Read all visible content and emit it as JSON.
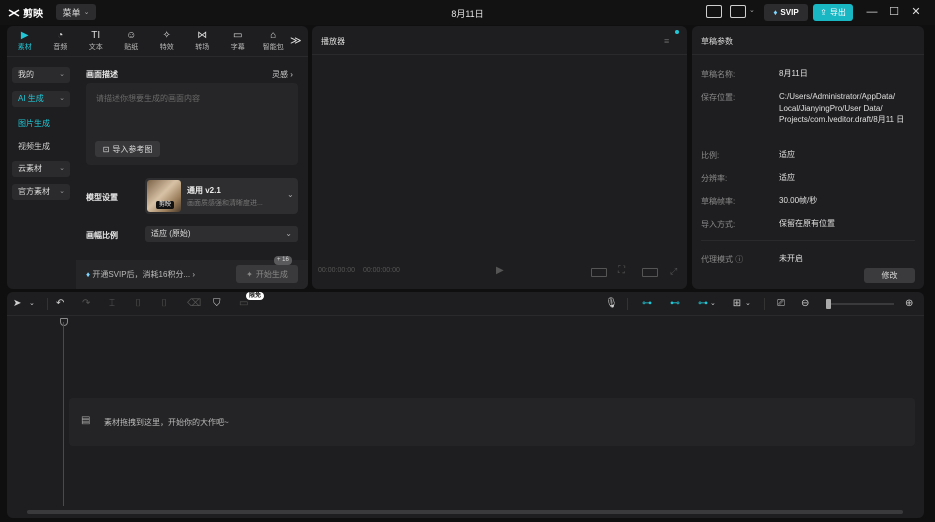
{
  "app": {
    "name": "剪映",
    "menu_label": "菜单",
    "title": "8月11日",
    "svip_label": "SVIP",
    "export_label": "导出"
  },
  "media_tabs": [
    {
      "label": "素材",
      "icon": "media-icon",
      "glyph": "▶",
      "active": true
    },
    {
      "label": "音频",
      "icon": "audio-icon",
      "glyph": "◔",
      "active": false
    },
    {
      "label": "文本",
      "icon": "text-icon",
      "glyph": "TI",
      "active": false
    },
    {
      "label": "贴纸",
      "icon": "sticker-icon",
      "glyph": "☺",
      "active": false
    },
    {
      "label": "特效",
      "icon": "effects-icon",
      "glyph": "✧",
      "active": false
    },
    {
      "label": "转场",
      "icon": "transition-icon",
      "glyph": "⋈",
      "active": false
    },
    {
      "label": "字幕",
      "icon": "subtitle-icon",
      "glyph": "▭",
      "active": false
    },
    {
      "label": "智能包",
      "icon": "smart-package-icon",
      "glyph": "⌂",
      "active": false
    }
  ],
  "media_tabs_more": "≫",
  "sidebar": {
    "mine": "我的",
    "ai_generate": "AI 生成",
    "image_generate": "图片生成",
    "video_generate": "视频生成",
    "cloud_material": "云素材",
    "official_material": "官方素材"
  },
  "ai_gen": {
    "description_label": "画面描述",
    "inspiration_label": "灵感",
    "placeholder": "请描述你想要生成的画面内容",
    "ref_button": "导入参考图",
    "model_label": "模型设置",
    "model_name": "通用 v2.1",
    "model_desc": "画面质感强和清晰度进...",
    "model_badge": "剪映",
    "ratio_label": "画幅比例",
    "ratio_value": "适应 (原始)",
    "svip_promo": "开通SVIP后，消耗16积分...",
    "generate_button": "开始生成",
    "gen_badge": "+ 16"
  },
  "player": {
    "title": "播放器",
    "time_current": "00:00:00:00",
    "time_total": "00:00:00:00"
  },
  "draft_props": {
    "title": "草稿参数",
    "rows": [
      {
        "label": "草稿名称:",
        "value": "8月11日"
      },
      {
        "label": "保存位置:",
        "value": "C:/Users/Administrator/AppData/ Local/JianyingPro/User Data/ Projects/com.lveditor.draft/8月11 日"
      },
      {
        "label": "比例:",
        "value": "适应"
      },
      {
        "label": "分辨率:",
        "value": "适应"
      },
      {
        "label": "草稿帧率:",
        "value": "30.00帧/秒"
      },
      {
        "label": "导入方式:",
        "value": "保留在原有位置"
      },
      {
        "label": "代理模式 ⓘ",
        "value": "未开启"
      }
    ],
    "modify_button": "修改"
  },
  "timeline": {
    "free_badge": "限免",
    "drop_hint": "素材拖拽到这里，开始你的大作吧~"
  },
  "colors": {
    "accent": "#21c7d6",
    "background": "#0f0f10",
    "panel": "#1e1e20"
  }
}
